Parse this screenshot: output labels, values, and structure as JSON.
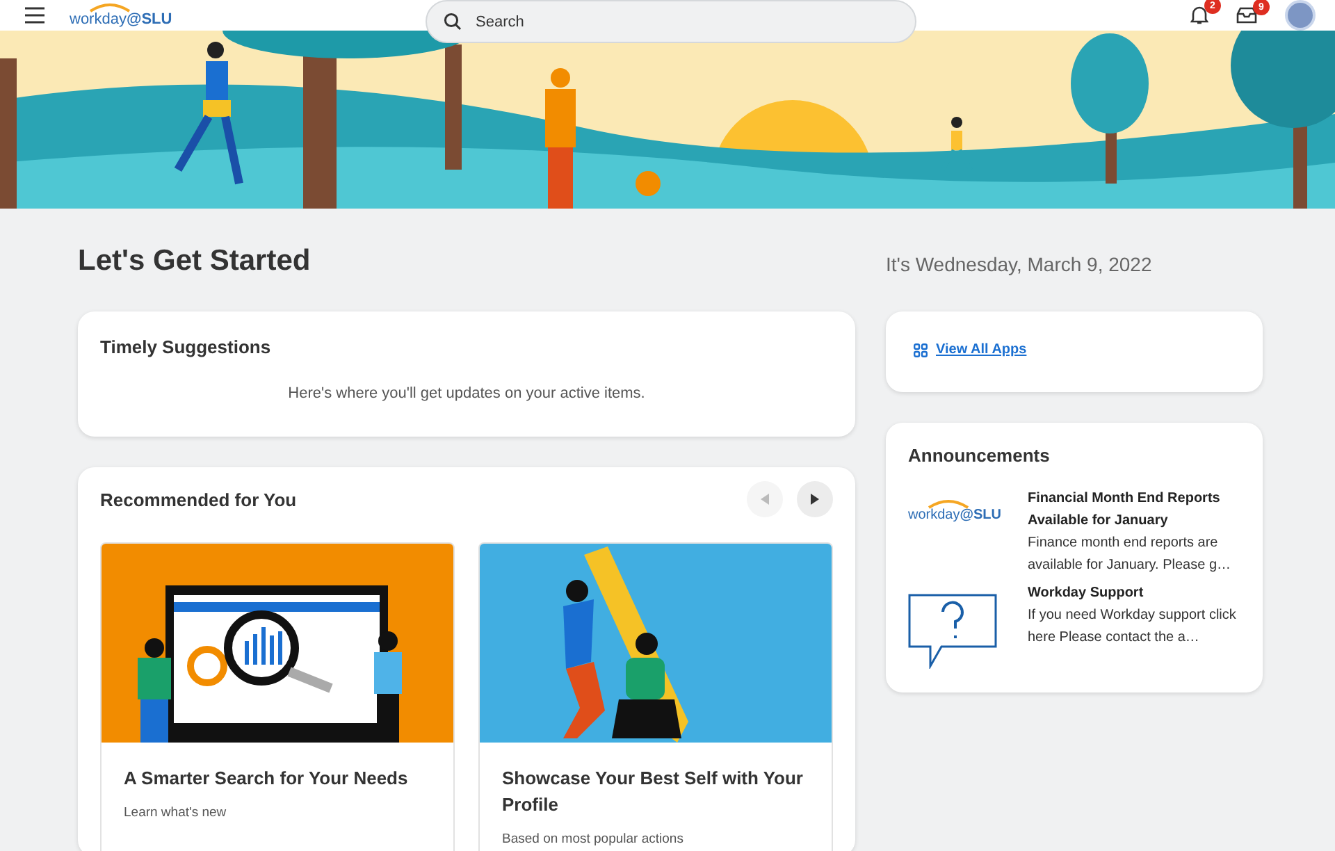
{
  "header": {
    "logo": {
      "word": "workday",
      "suffix": "@SLU"
    },
    "search": {
      "placeholder": "Search"
    },
    "notifications": {
      "badge": "2"
    },
    "inbox": {
      "badge": "9"
    }
  },
  "page": {
    "title": "Let's Get Started",
    "date": "It's Wednesday, March 9, 2022"
  },
  "timely_suggestions": {
    "title": "Timely Suggestions",
    "message": "Here's where you'll get updates on your active items."
  },
  "recommended": {
    "title": "Recommended for You",
    "prev_disabled": true,
    "next_disabled": false,
    "cards": [
      {
        "kind": "search",
        "title": "A Smarter Search for Your Needs",
        "subtitle": "Learn what's new"
      },
      {
        "kind": "profile",
        "title": "Showcase Your Best Self with Your Profile",
        "subtitle": "Based on most popular actions"
      }
    ]
  },
  "apps_link": "View All Apps",
  "announcements": {
    "title": "Announcements",
    "items": [
      {
        "kind": "logo",
        "logo": {
          "word": "workday",
          "suffix": "@SLU"
        },
        "title": "Financial Month End Reports Available for January",
        "body": "Finance month end reports are available for January. Please g…"
      },
      {
        "kind": "help",
        "title": "Workday Support",
        "body": "If you need Workday support click here Please contact the a…"
      }
    ]
  }
}
